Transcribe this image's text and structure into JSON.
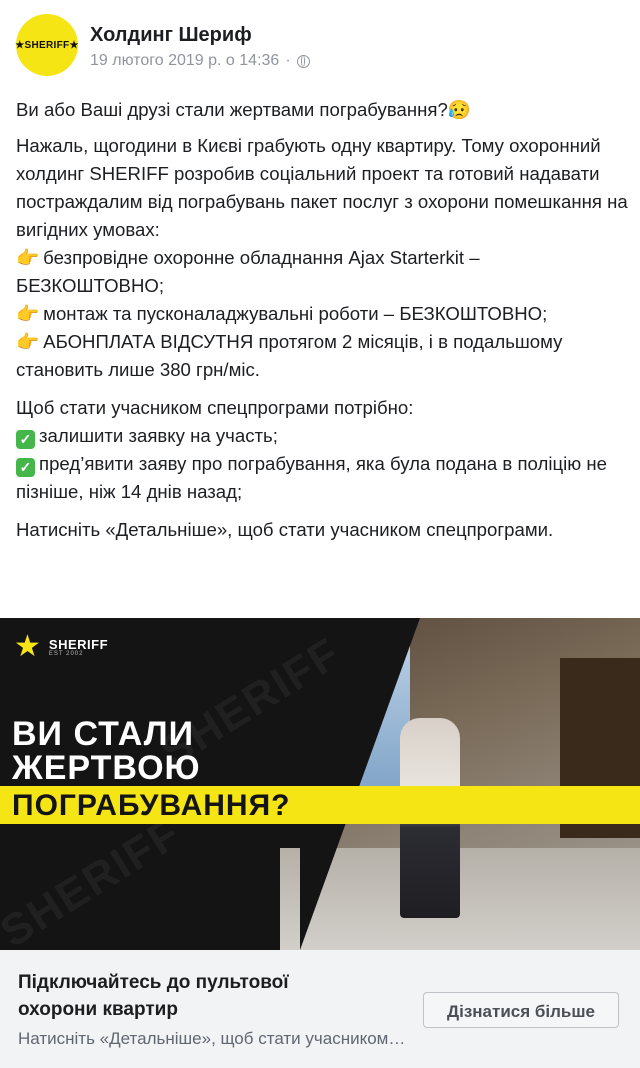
{
  "post": {
    "page_name": "Холдинг Шериф",
    "avatar_text": "★SHERIFF★",
    "date": "19 лютого 2019 р. о 14:36",
    "separator": "·",
    "privacy_icon": "globe-icon",
    "paragraphs": [
      "Ви або Ваші друзі стали жертвами пограбування?😥",
      "Нажаль, щогодини в Києві грабують одну квартиру. Тому охоронний холдинг SHERIFF розробив соціальний проект та готовий надавати постраждалим від пограбувань пакет послуг з охорони помешкання на вигідних умовах:"
    ],
    "bullets": [
      "безпровідне охоронне обладнання Ajax Starterkit – БЕЗКОШТОВНО;",
      "монтаж та пусконаладжувальні роботи – БЕЗКОШТОВНО;",
      "АБОНПЛАТА ВІДСУТНЯ протягом 2 місяців, і в подальшому становить лише 380 грн/міс."
    ],
    "bullet_emoji": "👉",
    "requirements_intro": "Щоб стати учасником спецпрограми потрібно:",
    "requirements": [
      "залишити заявку на участь;",
      "пред’явити заяву про пограбування, яка була подана в поліцію не пізніше, ніж 14 днів назад;"
    ],
    "check_mark": "✓",
    "closing": "Натисніть «Детальніше», щоб стати учасником спецпрограми."
  },
  "ad_image": {
    "logo_text": "SHERIFF",
    "logo_sub": "EST 2002",
    "headline_line1": "ВИ СТАЛИ",
    "headline_line2": "ЖЕРТВОЮ",
    "headline_line3": "ПОГРАБУВАННЯ?",
    "watermark": "SHERIFF",
    "accent_color": "#f5e515"
  },
  "link_card": {
    "title": "Підключайтесь до пультової охорони квартир",
    "description": "Натисніть «Детальніше», щоб стати учасником спецпрограми.",
    "cta_label": "Дізнатися більше"
  }
}
